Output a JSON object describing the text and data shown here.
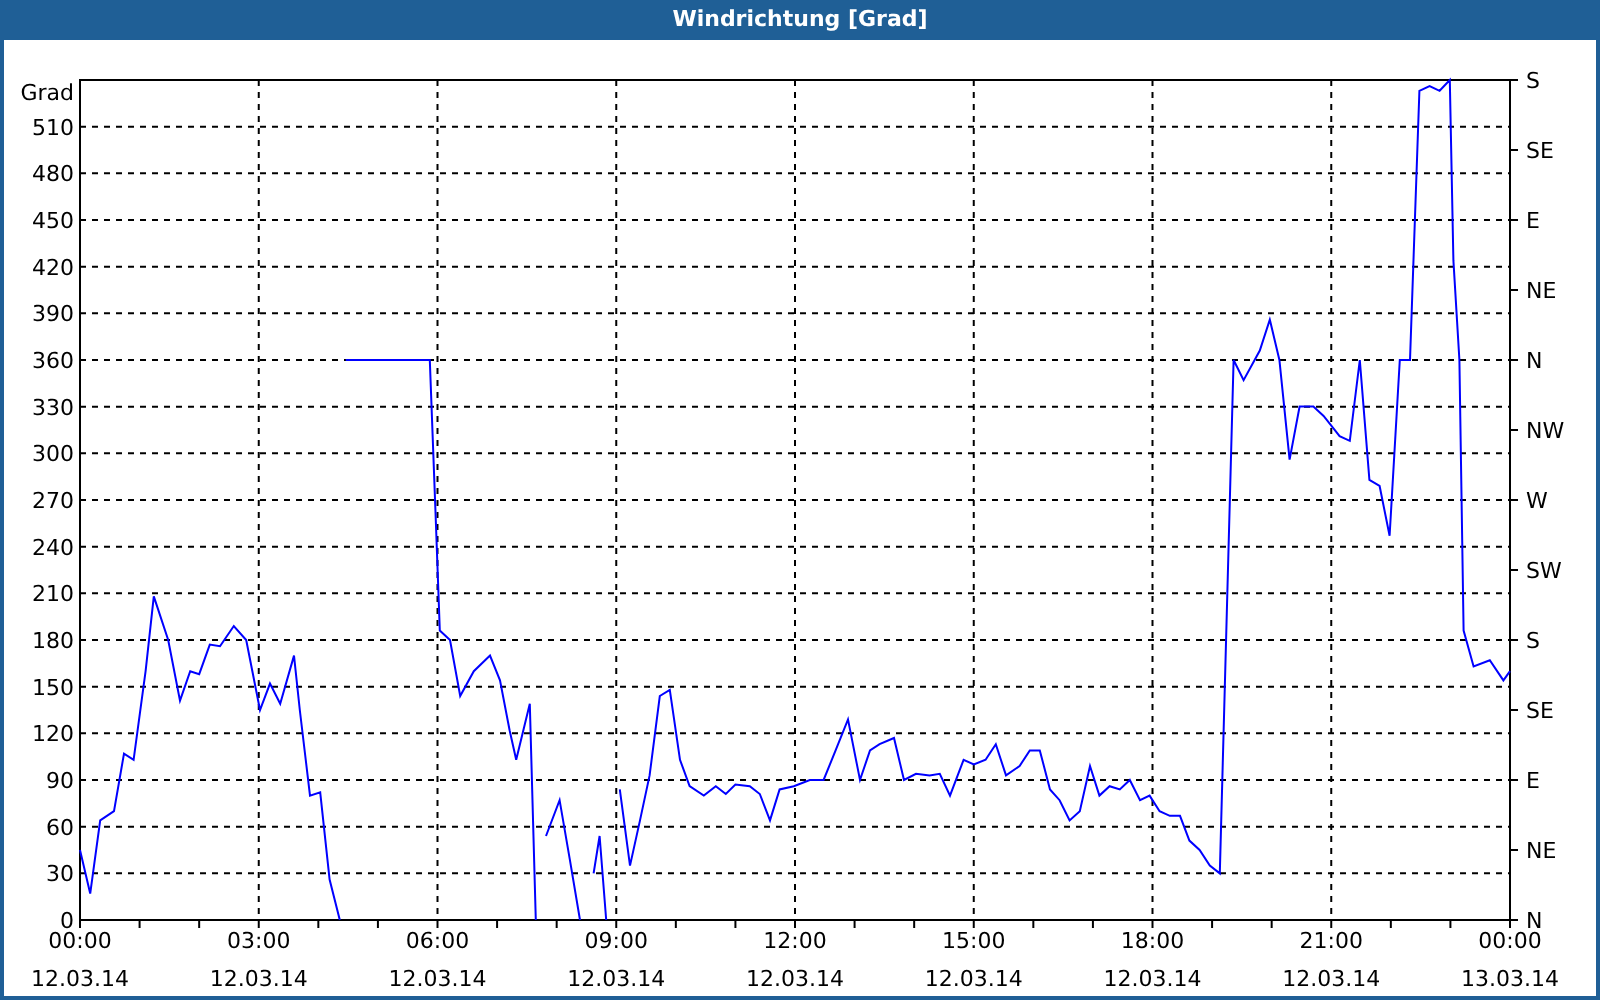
{
  "window": {
    "title": "Windrichtung [Grad]"
  },
  "chart_data": {
    "type": "line",
    "ylabel": "Grad",
    "xlim": [
      0,
      24
    ],
    "ylim": [
      0,
      540
    ],
    "yticks": [
      0,
      30,
      60,
      90,
      120,
      150,
      180,
      210,
      240,
      270,
      300,
      330,
      360,
      390,
      420,
      450,
      480,
      510
    ],
    "grid": true,
    "xticks": [
      {
        "value": 0,
        "label": "00:00"
      },
      {
        "value": 3,
        "label": "03:00"
      },
      {
        "value": 6,
        "label": "06:00"
      },
      {
        "value": 9,
        "label": "09:00"
      },
      {
        "value": 12,
        "label": "12:00"
      },
      {
        "value": 15,
        "label": "15:00"
      },
      {
        "value": 18,
        "label": "18:00"
      },
      {
        "value": 21,
        "label": "21:00"
      },
      {
        "value": 24,
        "label": "00:00"
      }
    ],
    "x": [
      0,
      0.17,
      0.34,
      0.57,
      0.74,
      0.9,
      1.1,
      1.24,
      1.48,
      1.68,
      1.85,
      2.0,
      2.18,
      2.35,
      2.58,
      2.79,
      3.02,
      3.19,
      3.36,
      3.59,
      3.69,
      3.86,
      4.03,
      4.19,
      4.36,
      4.4,
      4.46,
      5.87,
      5.97,
      6.04,
      6.21,
      6.38,
      6.61,
      6.88,
      7.05,
      7.21,
      7.32,
      7.55,
      7.65,
      7.7,
      7.82,
      8.05,
      8.22,
      8.39,
      8.5,
      8.62,
      8.72,
      8.83,
      8.9,
      9.06,
      9.23,
      9.4,
      9.56,
      9.73,
      9.9,
      10.07,
      10.23,
      10.47,
      10.67,
      10.84,
      11.0,
      11.24,
      11.41,
      11.58,
      11.74,
      11.98,
      12.25,
      12.48,
      12.68,
      12.89,
      13.09,
      13.26,
      13.42,
      13.66,
      13.83,
      14.03,
      14.26,
      14.43,
      14.6,
      14.83,
      15.0,
      15.2,
      15.37,
      15.54,
      15.77,
      15.94,
      16.11,
      16.28,
      16.44,
      16.61,
      16.78,
      16.95,
      17.11,
      17.28,
      17.45,
      17.62,
      17.79,
      17.95,
      18.12,
      18.29,
      18.46,
      18.62,
      18.79,
      18.96,
      19.13,
      19.36,
      19.53,
      19.8,
      19.97,
      20.13,
      20.3,
      20.47,
      20.7,
      20.87,
      21.14,
      21.31,
      21.48,
      21.64,
      21.81,
      21.98,
      22.15,
      22.32,
      22.48,
      22.65,
      22.82,
      22.99,
      23.05,
      23.15,
      23.22,
      23.39,
      23.66,
      23.89,
      24
    ],
    "series": [
      {
        "color": "#0000ff",
        "values": [
          45,
          17,
          64,
          70,
          107,
          103,
          160,
          208,
          180,
          141,
          160,
          158,
          177,
          176,
          189,
          180,
          135,
          152,
          139,
          170,
          135,
          80,
          82,
          26,
          0,
          null,
          360,
          360,
          257,
          186,
          180,
          144,
          160,
          170,
          154,
          122,
          103,
          139,
          0,
          null,
          54,
          77,
          39,
          0,
          null,
          30,
          54,
          0,
          null,
          84,
          35,
          64,
          93,
          144,
          148,
          103,
          86,
          80,
          86,
          81,
          87,
          86,
          81,
          64,
          84,
          86,
          90,
          90,
          109,
          129,
          90,
          109,
          113,
          117,
          90,
          94,
          93,
          94,
          80,
          103,
          100,
          103,
          113,
          93,
          99,
          109,
          109,
          84,
          77,
          64,
          70,
          99,
          80,
          86,
          84,
          90,
          77,
          80,
          70,
          67,
          67,
          51,
          45,
          35,
          30,
          360,
          347,
          366,
          386,
          360,
          296,
          330,
          330,
          324,
          311,
          308,
          360,
          283,
          279,
          247,
          360,
          360,
          533,
          536,
          533,
          540,
          424,
          360,
          186,
          163,
          167,
          154,
          160
        ]
      }
    ]
  },
  "x_axis_dates": [
    "12.03.14",
    "12.03.14",
    "12.03.14",
    "12.03.14",
    "12.03.14",
    "12.03.14",
    "12.03.14",
    "12.03.14",
    "13.03.14"
  ],
  "direction_axis": {
    "labels": [
      "S",
      "SE",
      "E",
      "NE",
      "N",
      "NW",
      "W",
      "SW",
      "S",
      "SE",
      "E",
      "NE",
      "N"
    ]
  }
}
